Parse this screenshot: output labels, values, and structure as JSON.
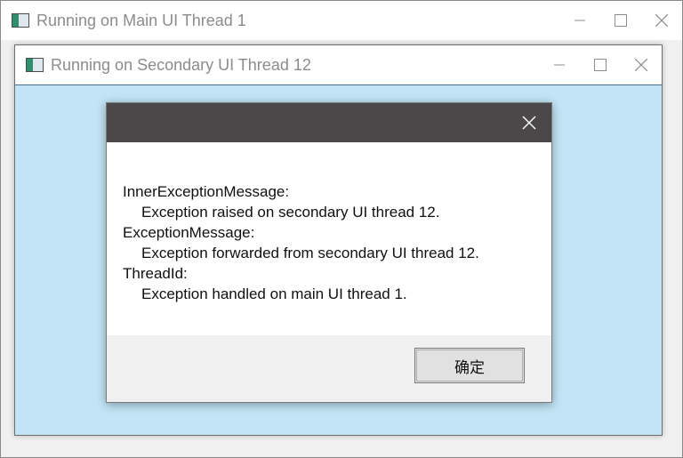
{
  "main_window": {
    "title": "Running on Main UI Thread 1",
    "icon": "app-window-icon"
  },
  "secondary_window": {
    "title": "Running on Secondary UI Thread 12",
    "icon": "app-window-icon"
  },
  "dialog": {
    "close_icon": "close-icon",
    "messages": [
      {
        "key": "InnerExceptionMessage:",
        "value": "Exception raised on secondary UI thread 12."
      },
      {
        "key": "ExceptionMessage:",
        "value": "Exception forwarded from secondary UI thread 12."
      },
      {
        "key": "ThreadId:",
        "value": "Exception handled on main UI thread 1."
      }
    ],
    "ok_label": "确定"
  },
  "colors": {
    "client_background": "#c2e4f5",
    "dialog_titlebar": "#4a4848",
    "footer": "#f0f0f0"
  }
}
